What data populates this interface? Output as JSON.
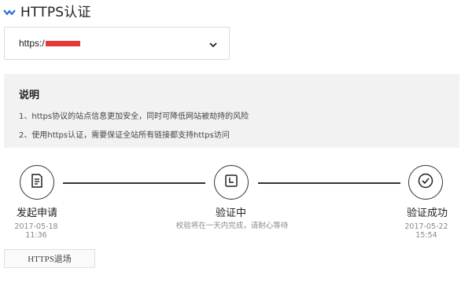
{
  "header": {
    "title": "HTTPS认证",
    "logo_icon": "check-chevron-icon",
    "accent": "#2a6fdb"
  },
  "domain_select": {
    "value": "https:/",
    "redacted": true,
    "icon": "chevron-down-icon"
  },
  "note": {
    "heading": "说明",
    "lines": [
      "1、https协议的站点信息更加安全，同时可降低网站被劫持的风险",
      "2、使用https认证，需要保证全站所有链接都支持https访问"
    ]
  },
  "steps": [
    {
      "label": "发起申请",
      "meta": "2017-05-18 11:36",
      "icon": "document-icon"
    },
    {
      "label": "验证中",
      "meta": "校验将在一天内完成，请耐心等待",
      "icon": "clock-icon"
    },
    {
      "label": "验证成功",
      "meta": "2017-05-22 15:54",
      "icon": "check-circle-icon"
    }
  ],
  "exit_button": {
    "label": "HTTPS退场"
  }
}
